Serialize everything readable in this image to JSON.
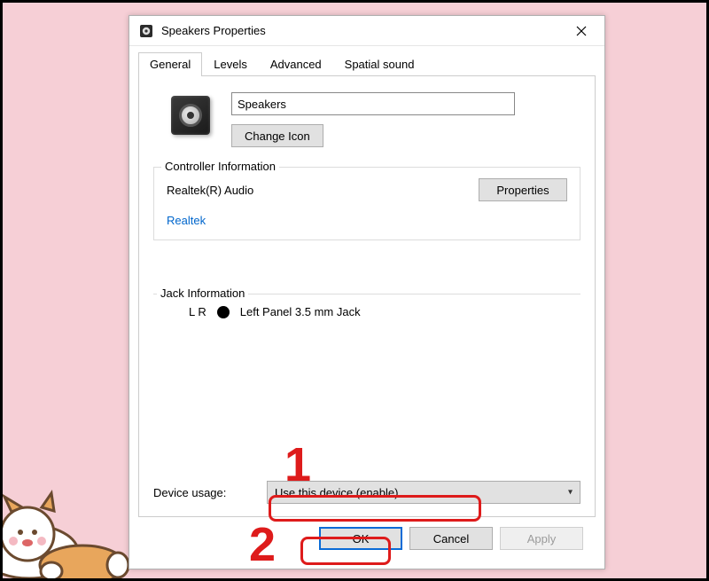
{
  "window": {
    "title": "Speakers Properties"
  },
  "tabs": {
    "general": "General",
    "levels": "Levels",
    "advanced": "Advanced",
    "spatial": "Spatial sound"
  },
  "device": {
    "name": "Speakers",
    "change_icon": "Change Icon"
  },
  "controller": {
    "legend": "Controller Information",
    "name": "Realtek(R) Audio",
    "properties_btn": "Properties",
    "vendor": "Realtek"
  },
  "jack": {
    "legend": "Jack Information",
    "channels": "L R",
    "desc": "Left Panel 3.5 mm Jack"
  },
  "usage": {
    "label": "Device usage:",
    "value": "Use this device (enable)"
  },
  "buttons": {
    "ok": "OK",
    "cancel": "Cancel",
    "apply": "Apply"
  },
  "annotations": {
    "n1": "1",
    "n2": "2"
  }
}
